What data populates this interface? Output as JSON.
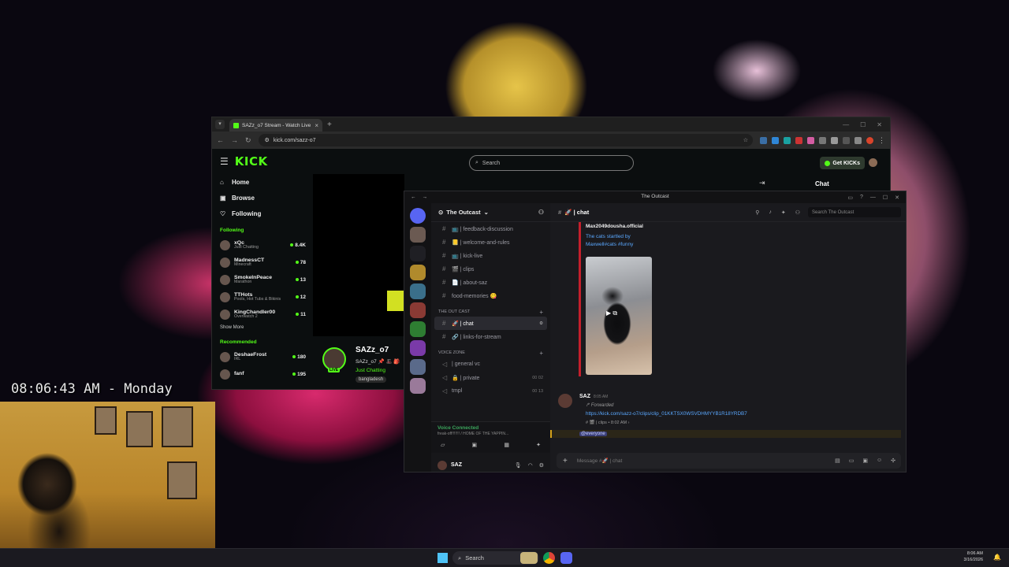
{
  "browser": {
    "tab_title": "SAZz_o7 Stream - Watch Live o",
    "url": "kick.com/sazz-o7",
    "new_tab": "+",
    "close": "×"
  },
  "kick": {
    "logo": "KICK",
    "search_placeholder": "Search",
    "get_kicks": "Get KICKs",
    "nav": [
      {
        "label": "Home",
        "icon": "home-icon"
      },
      {
        "label": "Browse",
        "icon": "browse-icon"
      },
      {
        "label": "Following",
        "icon": "heart-icon"
      }
    ],
    "following_title": "Following",
    "following": [
      {
        "name": "xQc",
        "category": "Just Chatting",
        "viewers": "8.4K"
      },
      {
        "name": "MadnessCT",
        "category": "Minecraft",
        "viewers": "78"
      },
      {
        "name": "SmokeInPeace",
        "category": "Marathon",
        "viewers": "13"
      },
      {
        "name": "TTHots",
        "category": "Pools, Hot Tubs & Bikinis",
        "viewers": "12"
      },
      {
        "name": "KingChandler00",
        "category": "Overwatch 2",
        "viewers": "11"
      }
    ],
    "show_more": "Show More",
    "recommended_title": "Recommended",
    "recommended": [
      {
        "name": "DeshaeFrost",
        "category": "IRL",
        "viewers": "180"
      },
      {
        "name": "fanf",
        "category": "",
        "viewers": "195"
      }
    ],
    "channel": {
      "name": "SAZz_o7",
      "subtitle": "SAZz_o7 📌 🎩 🎒",
      "category": "Just Chatting",
      "tag": "bangladesh",
      "live_badge": "LIVE"
    },
    "chat_label": "Chat"
  },
  "discord": {
    "window_title": "The Outcast",
    "server_name": "The Outcast",
    "channels_top": [
      {
        "name": "📺 | feedback-discussion",
        "icon": "#"
      },
      {
        "name": "📒 | welcome-and-rules",
        "icon": "#"
      },
      {
        "name": "📺 | kick-live",
        "icon": "#"
      },
      {
        "name": "🎬 | clips",
        "icon": "#"
      },
      {
        "name": "📄 | about-saz",
        "icon": "#"
      },
      {
        "name": "food-memories 😋",
        "icon": "#"
      }
    ],
    "category_text": "THE OUT CAST",
    "text_channels": [
      {
        "name": "🚀 | chat",
        "icon": "#",
        "active": true
      },
      {
        "name": "🔗 | links-for-stream",
        "icon": "#",
        "active": false
      }
    ],
    "category_voice": "VOICE ZONE",
    "voice_channels": [
      {
        "name": "| general vc",
        "count": ""
      },
      {
        "name": "🔒 | private",
        "count": "00  02"
      },
      {
        "name": "tmpl",
        "count": "00  13"
      }
    ],
    "voice_connected": "Voice Connected",
    "voice_sub": "freak-off!!!!!!! / HOME OF THE YAPPIN...",
    "user_name": "SAZ",
    "channel_header": "🚀 | chat",
    "search_placeholder": "Search The Outcast",
    "forward_author": "Max2049dousha.official",
    "forward_text": "The cats startled by Maxwell#cats #funny",
    "message": {
      "author": "SAZ",
      "time": "8:05 AM",
      "forwarded": "↱ Forwarded",
      "link": "https://kick.com/sazz-o7/clips/clip_01KKTSX0WSVDHMYYB1R18YRDB7",
      "meta": "# 🎬 | clips • 8:02 AM ›",
      "mention": "@everyone"
    },
    "composer_placeholder": "Message #🚀 | chat"
  },
  "overlay": {
    "clock_text": "08:06:43 AM - Monday"
  },
  "taskbar": {
    "search_label": "Search",
    "time": "8:06 AM",
    "date": "3/16/2026"
  }
}
